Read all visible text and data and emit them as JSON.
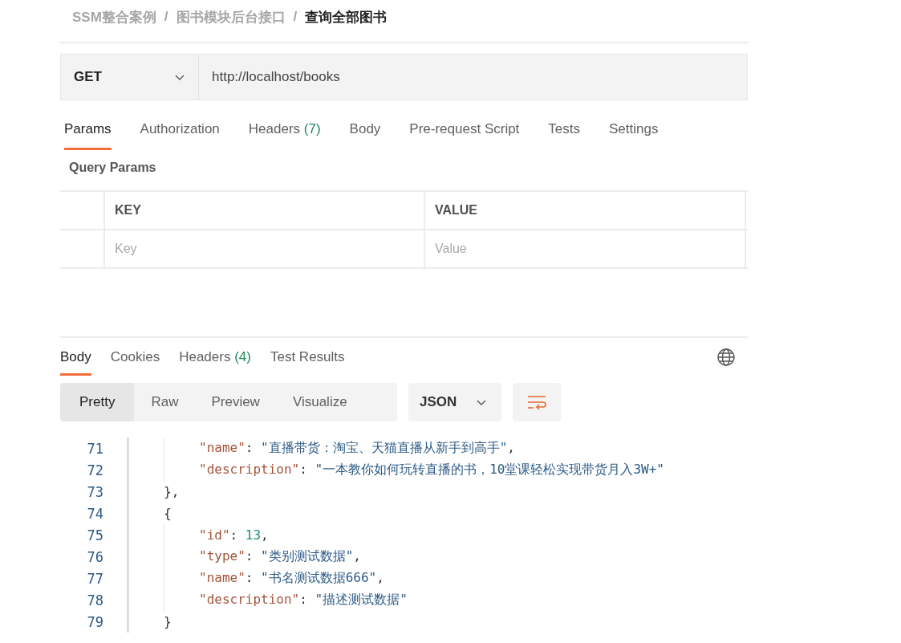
{
  "breadcrumb": [
    {
      "label": "SSM整合案例",
      "current": false
    },
    {
      "label": "图书模块后台接口",
      "current": false
    },
    {
      "label": "查询全部图书",
      "current": true
    }
  ],
  "breadcrumb_separator": "/",
  "request": {
    "method": "GET",
    "url": "http://localhost/books"
  },
  "request_tabs": [
    {
      "label": "Params",
      "selected": true
    },
    {
      "label": "Authorization",
      "selected": false
    },
    {
      "label": "Headers",
      "count": "(7)",
      "selected": false
    },
    {
      "label": "Body",
      "selected": false
    },
    {
      "label": "Pre-request Script",
      "selected": false
    },
    {
      "label": "Tests",
      "selected": false
    },
    {
      "label": "Settings",
      "selected": false
    }
  ],
  "query_params": {
    "title": "Query Params",
    "columns": [
      "KEY",
      "VALUE"
    ],
    "placeholders": [
      "Key",
      "Value"
    ]
  },
  "response_tabs": [
    {
      "label": "Body",
      "selected": true
    },
    {
      "label": "Cookies",
      "selected": false
    },
    {
      "label": "Headers",
      "count": "(4)",
      "selected": false
    },
    {
      "label": "Test Results",
      "selected": false
    }
  ],
  "view_modes": [
    {
      "label": "Pretty",
      "selected": true
    },
    {
      "label": "Raw",
      "selected": false
    },
    {
      "label": "Preview",
      "selected": false
    },
    {
      "label": "Visualize",
      "selected": false
    }
  ],
  "format": "JSON",
  "code_lines": [
    {
      "number": "71",
      "tokens": [
        {
          "kind": "key",
          "text": "\"name\""
        },
        {
          "kind": "punct",
          "text": ": "
        },
        {
          "kind": "string",
          "text": "\"直播带货：淘宝、天猫直播从新手到高手\""
        },
        {
          "kind": "punct",
          "text": ","
        }
      ]
    },
    {
      "number": "72",
      "tokens": [
        {
          "kind": "key",
          "text": "\"description\""
        },
        {
          "kind": "punct",
          "text": ": "
        },
        {
          "kind": "string",
          "text": "\"一本教你如何玩转直播的书，10堂课轻松实现带货月入3W+\""
        }
      ]
    },
    {
      "number": "73",
      "tokens": [
        {
          "kind": "punct",
          "text": "},"
        }
      ]
    },
    {
      "number": "74",
      "tokens": [
        {
          "kind": "punct",
          "text": "{"
        }
      ]
    },
    {
      "number": "75",
      "tokens": [
        {
          "kind": "key",
          "text": "\"id\""
        },
        {
          "kind": "punct",
          "text": ": "
        },
        {
          "kind": "number",
          "text": "13"
        },
        {
          "kind": "punct",
          "text": ","
        }
      ]
    },
    {
      "number": "76",
      "tokens": [
        {
          "kind": "key",
          "text": "\"type\""
        },
        {
          "kind": "punct",
          "text": ": "
        },
        {
          "kind": "string",
          "text": "\"类别测试数据\""
        },
        {
          "kind": "punct",
          "text": ","
        }
      ]
    },
    {
      "number": "77",
      "tokens": [
        {
          "kind": "key",
          "text": "\"name\""
        },
        {
          "kind": "punct",
          "text": ": "
        },
        {
          "kind": "string",
          "text": "\"书名测试数据666\""
        },
        {
          "kind": "punct",
          "text": ","
        }
      ]
    },
    {
      "number": "78",
      "tokens": [
        {
          "kind": "key",
          "text": "\"description\""
        },
        {
          "kind": "punct",
          "text": ": "
        },
        {
          "kind": "string",
          "text": "\"描述测试数据\""
        }
      ]
    },
    {
      "number": "79",
      "tokens": [
        {
          "kind": "punct",
          "text": "}"
        }
      ]
    }
  ]
}
